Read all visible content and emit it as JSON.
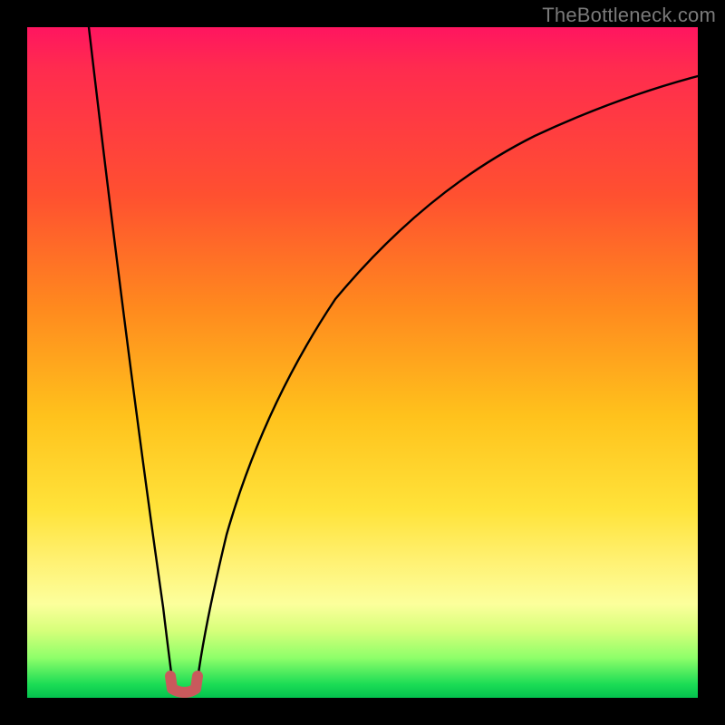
{
  "watermark": "TheBottleneck.com",
  "colors": {
    "frame": "#000000",
    "curve": "#000000",
    "marker": "#c9595c",
    "gradient_stops": [
      "#ff1560",
      "#ff8a1e",
      "#ffe33a",
      "#fcff9c",
      "#04c24e"
    ]
  },
  "chart_data": {
    "type": "line",
    "title": "",
    "xlabel": "",
    "ylabel": "",
    "xlim": [
      0,
      100
    ],
    "ylim": [
      0,
      100
    ],
    "x": [
      0,
      2,
      4,
      6,
      8,
      10,
      12,
      14,
      16,
      18,
      19,
      20,
      21,
      22,
      23,
      24,
      25,
      26,
      28,
      30,
      34,
      38,
      44,
      50,
      58,
      66,
      76,
      88,
      100
    ],
    "series": [
      {
        "name": "bottleneck",
        "values": [
          100,
          90,
          80,
          70,
          60,
          50,
          40,
          30,
          20,
          10,
          5,
          1,
          0,
          0,
          1,
          5,
          12,
          20,
          30,
          38,
          48,
          56,
          64,
          70,
          76,
          82,
          87,
          92,
          96
        ]
      }
    ],
    "marker": {
      "x_range": [
        20,
        24
      ],
      "y": 0
    },
    "annotations": []
  }
}
